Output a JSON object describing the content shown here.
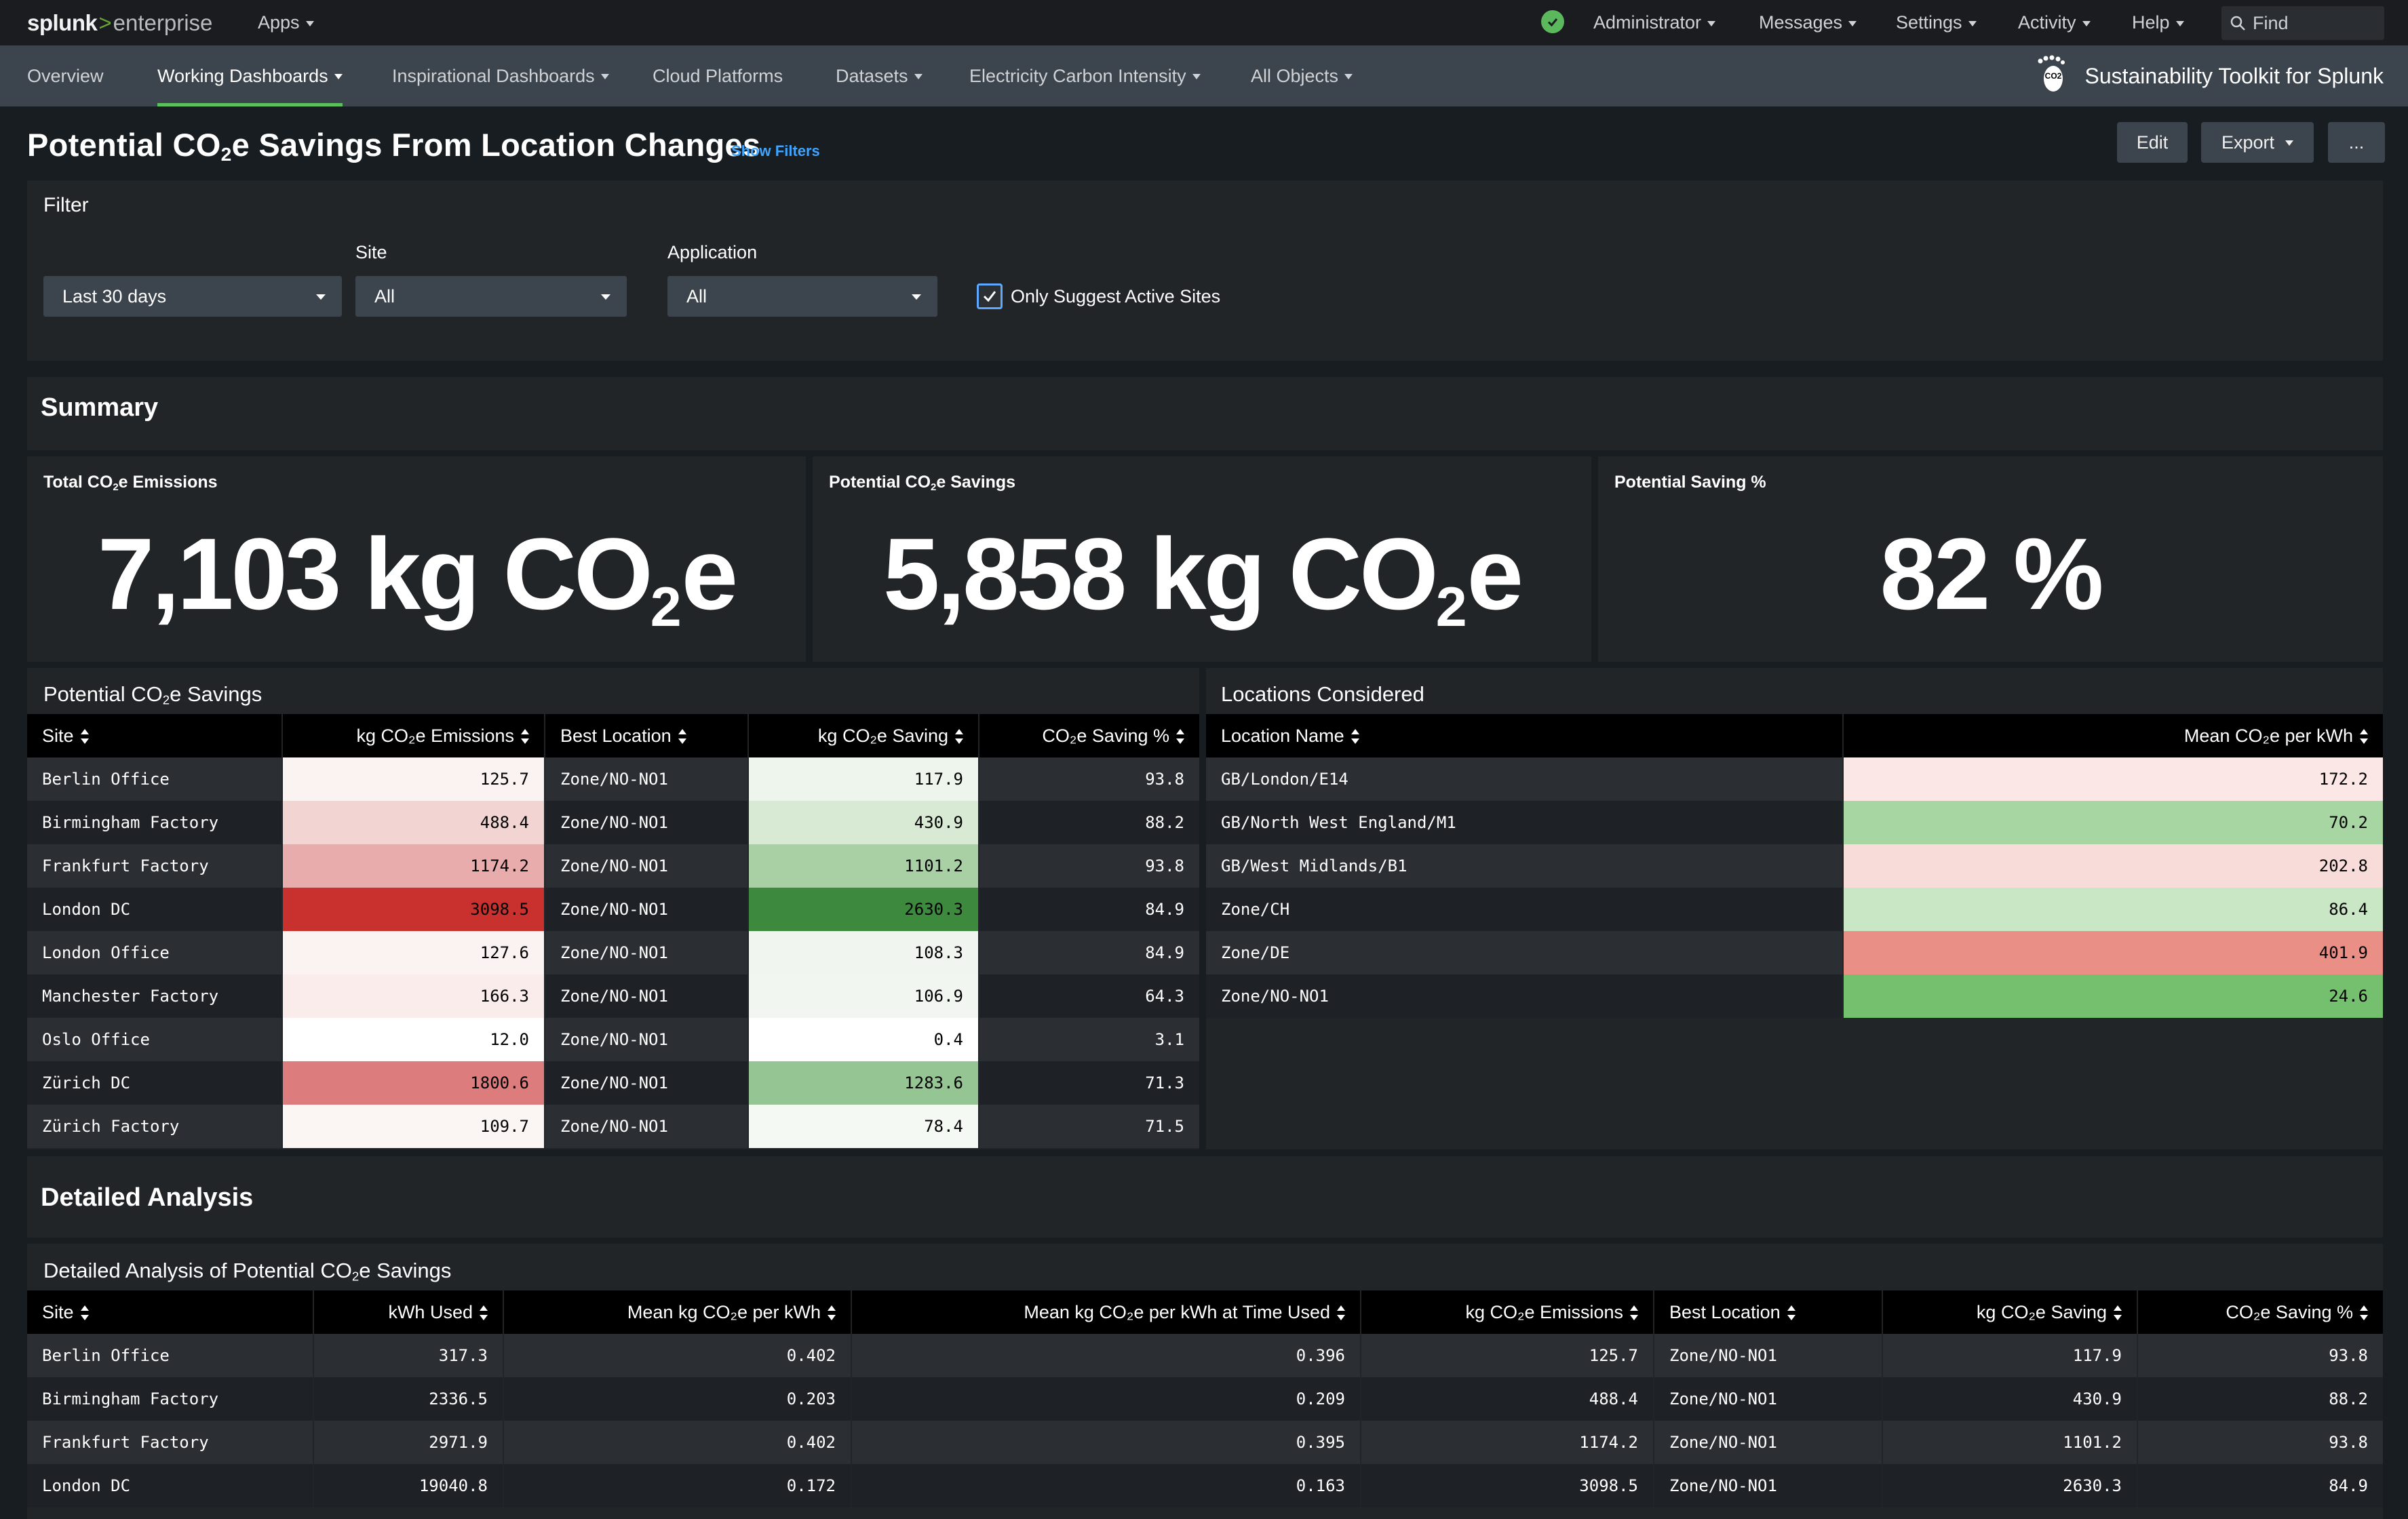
{
  "topbar": {
    "logo_splunk": "splunk",
    "logo_gt": ">",
    "logo_enterprise": "enterprise",
    "apps": "Apps",
    "administrator": "Administrator",
    "messages": "Messages",
    "settings": "Settings",
    "activity": "Activity",
    "help": "Help",
    "find_placeholder": "Find"
  },
  "appnav": {
    "overview": "Overview",
    "working_dashboards": "Working Dashboards",
    "inspirational_dashboards": "Inspirational Dashboards",
    "cloud_platforms": "Cloud Platforms",
    "datasets": "Datasets",
    "electricity": "Electricity Carbon Intensity",
    "all_objects": "All Objects",
    "app_title": "Sustainability Toolkit for Splunk",
    "app_icon_text": "CO2"
  },
  "page": {
    "title_a": "Potential CO",
    "title_sub": "2",
    "title_b": "e Savings From Location Changes",
    "show_filters": "Show Filters",
    "edit": "Edit",
    "export": "Export",
    "more": "..."
  },
  "filter": {
    "title": "Filter",
    "time_value": "Last 30 days",
    "site_label": "Site",
    "site_value": "All",
    "app_label": "Application",
    "app_value": "All",
    "active_sites_label": "Only Suggest Active Sites",
    "active_sites_checked": true
  },
  "summary": {
    "title": "Summary",
    "total": {
      "label_a": "Total CO",
      "label_sub": "2",
      "label_b": "e Emissions",
      "value": "7,103 kg CO",
      "value_sub": "2",
      "value_end": "e"
    },
    "savings": {
      "label_a": "Potential CO",
      "label_sub": "2",
      "label_b": "e Savings",
      "value": "5,858 kg CO",
      "value_sub": "2",
      "value_end": "e"
    },
    "percent": {
      "label": "Potential Saving %",
      "value": "82 %"
    }
  },
  "savings_table": {
    "title_a": "Potential CO",
    "title_sub": "2",
    "title_b": "e Savings",
    "columns": [
      "Site",
      "kg CO₂e Emissions",
      "Best Location",
      "kg CO₂e Saving",
      "CO₂e Saving %"
    ],
    "rows": [
      [
        "Berlin Office",
        "125.7",
        "Zone/NO-NO1",
        "117.9",
        "93.8"
      ],
      [
        "Birmingham Factory",
        "488.4",
        "Zone/NO-NO1",
        "430.9",
        "88.2"
      ],
      [
        "Frankfurt Factory",
        "1174.2",
        "Zone/NO-NO1",
        "1101.2",
        "93.8"
      ],
      [
        "London DC",
        "3098.5",
        "Zone/NO-NO1",
        "2630.3",
        "84.9"
      ],
      [
        "London Office",
        "127.6",
        "Zone/NO-NO1",
        "108.3",
        "84.9"
      ],
      [
        "Manchester Factory",
        "166.3",
        "Zone/NO-NO1",
        "106.9",
        "64.3"
      ],
      [
        "Oslo Office",
        "12.0",
        "Zone/NO-NO1",
        "0.4",
        "3.1"
      ],
      [
        "Zürich DC",
        "1800.6",
        "Zone/NO-NO1",
        "1283.6",
        "71.3"
      ],
      [
        "Zürich Factory",
        "109.7",
        "Zone/NO-NO1",
        "78.4",
        "71.5"
      ]
    ],
    "emission_colors": [
      "#fbf3f2",
      "#f2d5d3",
      "#e9acac",
      "#c8312d",
      "#fbf3f2",
      "#f9eceb",
      "#ffffff",
      "#dc7c7c",
      "#fbf5f4"
    ],
    "saving_colors": [
      "#eef5ed",
      "#d8ead4",
      "#a8d0a4",
      "#3d8a3f",
      "#f0f6ef",
      "#f1f7f0",
      "#ffffff",
      "#95c592",
      "#f4f9f3"
    ]
  },
  "locations_table": {
    "title": "Locations Considered",
    "columns": [
      "Location Name",
      "Mean CO₂e per kWh"
    ],
    "rows": [
      [
        "GB/London/E14",
        "172.2"
      ],
      [
        "GB/North West England/M1",
        "70.2"
      ],
      [
        "GB/West Midlands/B1",
        "202.8"
      ],
      [
        "Zone/CH",
        "86.4"
      ],
      [
        "Zone/DE",
        "401.9"
      ],
      [
        "Zone/NO-NO1",
        "24.6"
      ]
    ],
    "value_colors": [
      "#fbe8e6",
      "#a8d6a3",
      "#f8dcda",
      "#c9e6c5",
      "#ea8f86",
      "#74c06e"
    ]
  },
  "detailed": {
    "section_title": "Detailed Analysis",
    "table_title_a": "Detailed Analysis of Potential CO",
    "table_title_sub": "2",
    "table_title_b": "e Savings",
    "columns": [
      "Site",
      "kWh Used",
      "Mean kg CO₂e per kWh",
      "Mean kg CO₂e per kWh at Time Used",
      "kg CO₂e Emissions",
      "Best Location",
      "kg CO₂e Saving",
      "CO₂e Saving %"
    ],
    "rows": [
      [
        "Berlin Office",
        "317.3",
        "0.402",
        "0.396",
        "125.7",
        "Zone/NO-NO1",
        "117.9",
        "93.8"
      ],
      [
        "Birmingham Factory",
        "2336.5",
        "0.203",
        "0.209",
        "488.4",
        "Zone/NO-NO1",
        "430.9",
        "88.2"
      ],
      [
        "Frankfurt Factory",
        "2971.9",
        "0.402",
        "0.395",
        "1174.2",
        "Zone/NO-NO1",
        "1101.2",
        "93.8"
      ],
      [
        "London DC",
        "19040.8",
        "0.172",
        "0.163",
        "3098.5",
        "Zone/NO-NO1",
        "2630.3",
        "84.9"
      ]
    ]
  }
}
